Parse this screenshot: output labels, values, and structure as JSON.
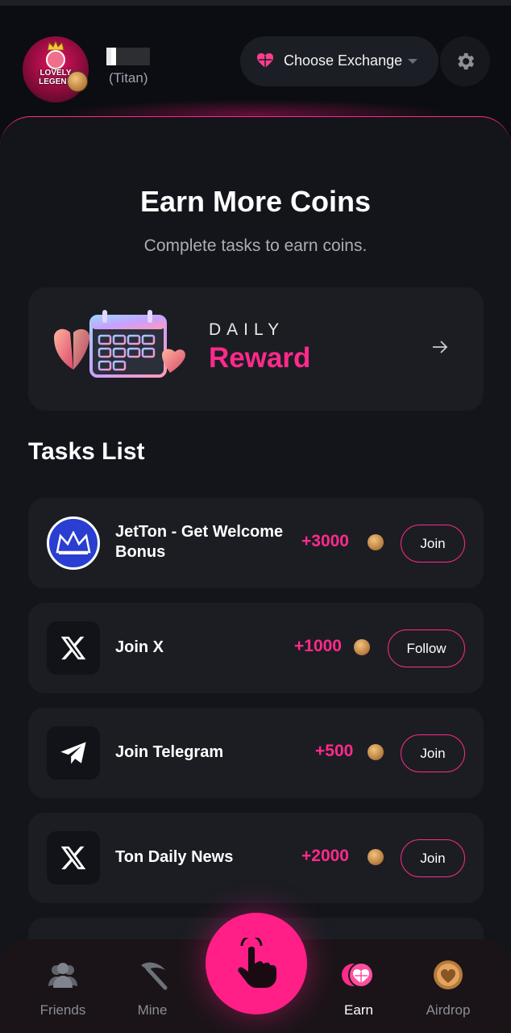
{
  "header": {
    "avatar_text": "LOVELY LEGEND",
    "user_rank": "(Titan)",
    "exchange_label": "Choose Exchange",
    "settings_icon": "gear-icon"
  },
  "main": {
    "title": "Earn More Coins",
    "subtitle": "Complete tasks to earn coins.",
    "daily": {
      "kicker": "DAILY",
      "title": "Reward"
    },
    "tasks_heading": "Tasks List",
    "tasks": [
      {
        "name": "JetTon - Get Welcome Bonus",
        "reward": "+3000",
        "action": "Join",
        "icon": "jetton-crown-icon"
      },
      {
        "name": "Join X",
        "reward": "+1000",
        "action": "Follow",
        "icon": "x-logo-icon"
      },
      {
        "name": "Join Telegram",
        "reward": "+500",
        "action": "Join",
        "icon": "telegram-icon"
      },
      {
        "name": "Ton Daily News",
        "reward": "+2000",
        "action": "Join",
        "icon": "x-logo-icon"
      }
    ]
  },
  "nav": {
    "items": [
      {
        "label": "Friends",
        "icon": "friends-icon"
      },
      {
        "label": "Mine",
        "icon": "pickaxe-icon"
      },
      {
        "label": "Earn",
        "icon": "earn-coin-icon"
      },
      {
        "label": "Airdrop",
        "icon": "airdrop-coin-icon"
      }
    ],
    "active": "Earn",
    "tap_icon": "tap-finger-icon"
  },
  "colors": {
    "accent": "#ff2a8a",
    "background": "#0b0d12",
    "card": "#1b1d23"
  }
}
